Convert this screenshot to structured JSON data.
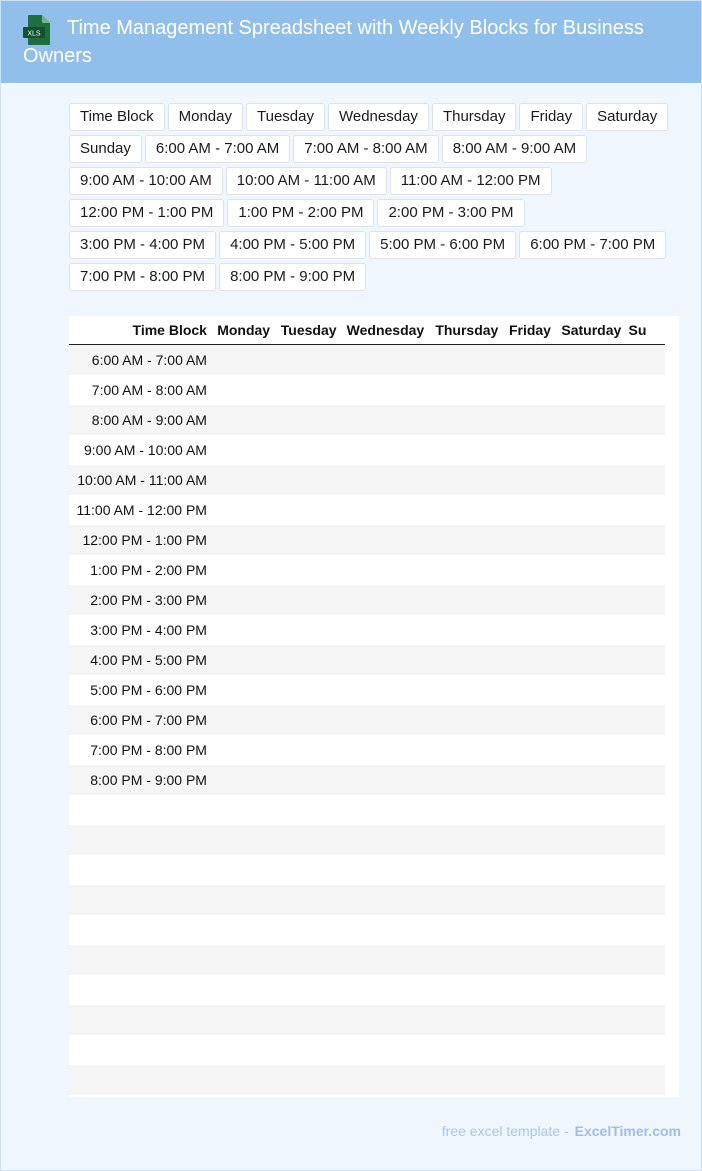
{
  "header": {
    "title": "Time Management Spreadsheet with Weekly Blocks for Business Owners",
    "icon": "xls-file-icon",
    "icon_label": "XLS",
    "background": "#8fbfea"
  },
  "chips": [
    "Time Block",
    "Monday",
    "Tuesday",
    "Wednesday",
    "Thursday",
    "Friday",
    "Saturday",
    "Sunday",
    "6:00 AM - 7:00 AM",
    "7:00 AM - 8:00 AM",
    "8:00 AM - 9:00 AM",
    "9:00 AM - 10:00 AM",
    "10:00 AM - 11:00 AM",
    "11:00 AM - 12:00 PM",
    "12:00 PM - 1:00 PM",
    "1:00 PM - 2:00 PM",
    "2:00 PM - 3:00 PM",
    "3:00 PM - 4:00 PM",
    "4:00 PM - 5:00 PM",
    "5:00 PM - 6:00 PM",
    "6:00 PM - 7:00 PM",
    "7:00 PM - 8:00 PM",
    "8:00 PM - 9:00 PM"
  ],
  "table": {
    "headers": [
      "Time Block",
      "Monday",
      "Tuesday",
      "Wednesday",
      "Thursday",
      "Friday",
      "Saturday",
      "Su"
    ],
    "rows": [
      {
        "idx": "0",
        "time": "6:00 AM - 7:00 AM"
      },
      {
        "idx": "1",
        "time": "7:00 AM - 8:00 AM"
      },
      {
        "idx": "2",
        "time": "8:00 AM - 9:00 AM"
      },
      {
        "idx": "3",
        "time": "9:00 AM - 10:00 AM"
      },
      {
        "idx": "4",
        "time": "10:00 AM - 11:00 AM"
      },
      {
        "idx": "5",
        "time": "11:00 AM - 12:00 PM"
      },
      {
        "idx": "6",
        "time": "12:00 PM - 1:00 PM"
      },
      {
        "idx": "7",
        "time": "1:00 PM - 2:00 PM"
      },
      {
        "idx": "8",
        "time": "2:00 PM - 3:00 PM"
      },
      {
        "idx": "9",
        "time": "3:00 PM - 4:00 PM"
      },
      {
        "idx": "0",
        "time": "4:00 PM - 5:00 PM"
      },
      {
        "idx": "1",
        "time": "5:00 PM - 6:00 PM"
      },
      {
        "idx": "2",
        "time": "6:00 PM - 7:00 PM"
      },
      {
        "idx": "3",
        "time": "7:00 PM - 8:00 PM"
      },
      {
        "idx": "4",
        "time": "8:00 PM - 9:00 PM"
      },
      {
        "idx": "5",
        "time": ""
      },
      {
        "idx": "6",
        "time": ""
      },
      {
        "idx": "7",
        "time": ""
      },
      {
        "idx": "8",
        "time": ""
      },
      {
        "idx": "9",
        "time": ""
      },
      {
        "idx": "0",
        "time": ""
      },
      {
        "idx": "1",
        "time": ""
      },
      {
        "idx": "2",
        "time": ""
      },
      {
        "idx": "3",
        "time": ""
      },
      {
        "idx": "4",
        "time": ""
      }
    ]
  },
  "footer": {
    "text": "free excel template -",
    "brand": "ExcelTimer.com"
  }
}
